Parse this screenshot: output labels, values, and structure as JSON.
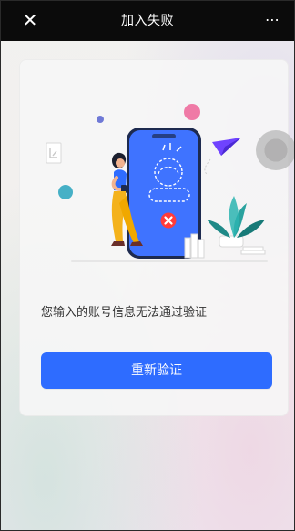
{
  "top_bar": {
    "title": "加入失败",
    "close_icon": "✕",
    "more_icon": "⋯"
  },
  "card": {
    "illustration_name": "verification-failed-illustration",
    "message": "您输入的账号信息无法通过验证",
    "button_label": "重新验证"
  },
  "colors": {
    "top_bar_bg": "#0b0b0b",
    "primary_button": "#2e6cff",
    "phone_screen": "#3f73ff",
    "error_red": "#ff3b3b"
  }
}
